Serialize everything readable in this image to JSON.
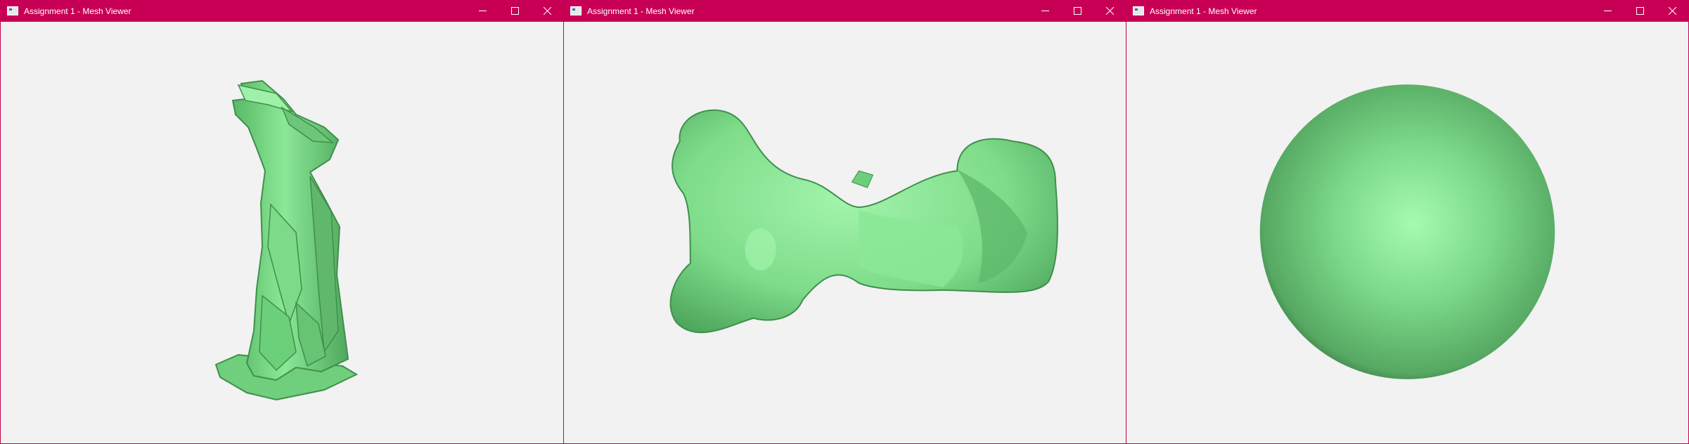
{
  "theme": {
    "titlebar_color": "#c80055",
    "viewport_background": "#f2f2f2",
    "mesh_color": "#7fe08a"
  },
  "windows": [
    {
      "title": "Assignment 1 - Mesh Viewer",
      "model": "gargoyle",
      "controls": [
        "minimize-icon",
        "maximize-icon",
        "close-icon"
      ]
    },
    {
      "title": "Assignment 1 - Mesh Viewer",
      "model": "gargoyle-top-view",
      "controls": [
        "minimize-icon",
        "maximize-icon",
        "close-icon"
      ]
    },
    {
      "title": "Assignment 1 - Mesh Viewer",
      "model": "sphere",
      "controls": [
        "minimize-icon",
        "maximize-icon",
        "close-icon"
      ]
    }
  ]
}
